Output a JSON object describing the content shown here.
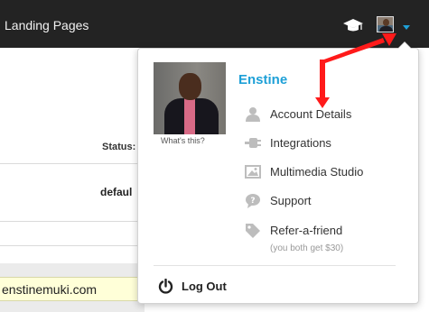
{
  "topbar": {
    "nav_item": "Landing Pages",
    "icons": [
      "graduation-cap-icon",
      "user-avatar",
      "caret-down-icon"
    ]
  },
  "background": {
    "status_label": "Status:",
    "row_value": "defaul",
    "url_value": "enstinemuki.com"
  },
  "dropdown": {
    "user_name": "Enstine",
    "photo_caption": "What's this?",
    "menu": [
      {
        "label": "Account Details",
        "icon": "user-icon"
      },
      {
        "label": "Integrations",
        "icon": "plug-icon"
      },
      {
        "label": "Multimedia Studio",
        "icon": "image-icon"
      },
      {
        "label": "Support",
        "icon": "chat-bubble-icon"
      },
      {
        "label": "Refer-a-friend",
        "icon": "tag-icon"
      }
    ],
    "refer_subtext": "(you both get $30)",
    "logout_label": "Log Out"
  },
  "colors": {
    "topbar_bg": "#232323",
    "accent": "#1ea0d7",
    "icon_grey": "#bdbdbd",
    "annotation_red": "#ff1a1a"
  }
}
